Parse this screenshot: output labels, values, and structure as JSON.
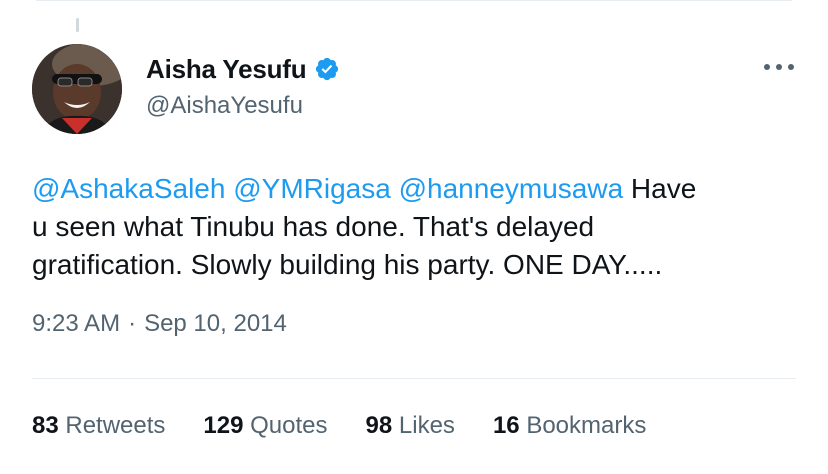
{
  "author": {
    "name": "Aisha Yesufu",
    "handle": "@AishaYesufu",
    "verified": true
  },
  "tweet": {
    "mentions": [
      "@AshakaSaleh",
      "@YMRigasa",
      "@hanneymusawa"
    ],
    "text_line1_rest": " Have",
    "text_line2": "u seen what Tinubu has done. That's delayed",
    "text_line3": "gratification. Slowly building his party. ONE DAY....."
  },
  "timestamp": {
    "time": "9:23 AM",
    "separator": "·",
    "date": "Sep 10, 2014"
  },
  "stats": [
    {
      "count": "83",
      "label": "Retweets"
    },
    {
      "count": "129",
      "label": "Quotes"
    },
    {
      "count": "98",
      "label": "Likes"
    },
    {
      "count": "16",
      "label": "Bookmarks"
    }
  ],
  "colors": {
    "accent": "#1d9bf0",
    "secondary_text": "#536471",
    "primary_text": "#0f1419"
  },
  "icons": {
    "verified": "verified-badge-icon",
    "more": "more-options-icon"
  }
}
